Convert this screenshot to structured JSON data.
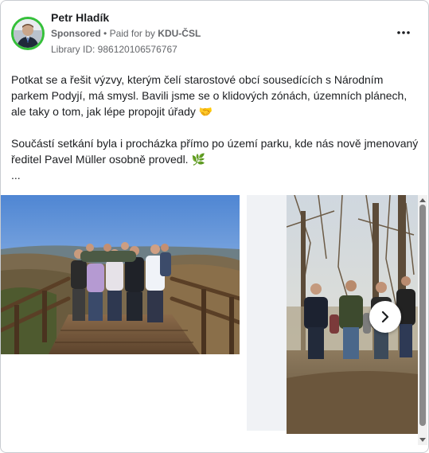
{
  "post": {
    "author": "Petr Hladík",
    "sponsored_label": "Sponsored",
    "separator": "•",
    "paid_for_prefix": "Paid for by",
    "payer": "KDU-ČSL",
    "library_id": "Library ID: 986120106576767"
  },
  "body": {
    "paragraph1": "Potkat se a řešit výzvy, kterým čelí starostové obcí sousedících s Národním parkem Podyjí, má smysl. Bavili jsme se o klidových zónách, územních plánech, ale taky o tom, jak lépe propojit úřady",
    "paragraph1_emoji": "🤝",
    "paragraph2": "Součástí setkání byla i procházka přímo po území parku, kde nás nově jmenovaný ředitel Pavel Müller osobně provedl.",
    "paragraph2_emoji": "🌿",
    "see_more": "..."
  },
  "carousel": {
    "slides": [
      {
        "icon": "group-photo-on-wooden-viewpoint"
      },
      {
        "icon": "group-walking-forest-path"
      }
    ],
    "next_icon": "chevron-right-icon"
  },
  "icons": {
    "more": "more-options-icon",
    "avatar": "profile-avatar"
  },
  "colors": {
    "avatar_ring": "#35c03a",
    "text_primary": "#1c1e21",
    "text_secondary": "#65676b",
    "card_border": "#c9ccd1"
  }
}
